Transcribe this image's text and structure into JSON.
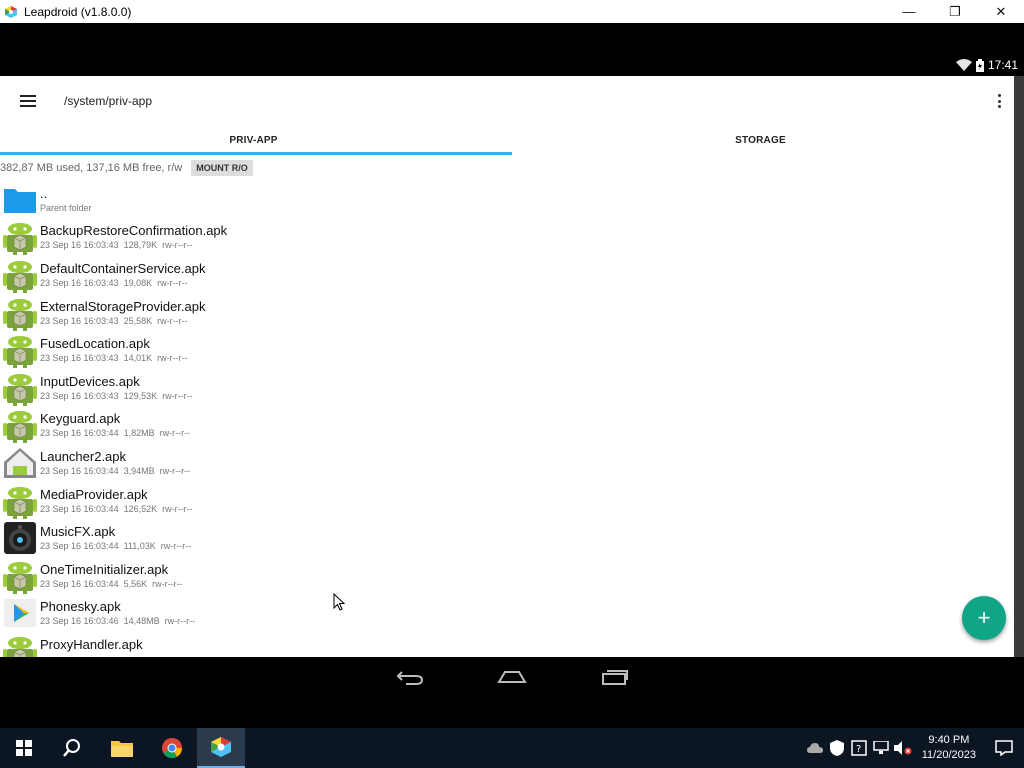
{
  "window": {
    "title": "Leapdroid (v1.8.0.0)",
    "minimize_glyph": "—",
    "restore_glyph": "❐",
    "close_glyph": "✕"
  },
  "android_status": {
    "time": "17:41"
  },
  "toolbar": {
    "path": "/system/priv-app"
  },
  "tabs": [
    {
      "label": "PRIV-APP",
      "selected": true
    },
    {
      "label": "STORAGE",
      "selected": false
    }
  ],
  "storage_info": {
    "text": "382,87 MB used, 137,16 MB free, r/w",
    "mount_button": "MOUNT R/O"
  },
  "files": [
    {
      "name": "..",
      "date": "Parent folder",
      "size": "",
      "perms": "",
      "icon": "folder-icon"
    },
    {
      "name": "BackupRestoreConfirmation.apk",
      "date": "23 Sep 16 16:03:43",
      "size": "128,79K",
      "perms": "rw-r--r--",
      "icon": "android-apk-icon"
    },
    {
      "name": "DefaultContainerService.apk",
      "date": "23 Sep 16 16:03:43",
      "size": "19,08K",
      "perms": "rw-r--r--",
      "icon": "android-apk-icon"
    },
    {
      "name": "ExternalStorageProvider.apk",
      "date": "23 Sep 16 16:03:43",
      "size": "25,58K",
      "perms": "rw-r--r--",
      "icon": "android-apk-icon"
    },
    {
      "name": "FusedLocation.apk",
      "date": "23 Sep 16 16:03:43",
      "size": "14,01K",
      "perms": "rw-r--r--",
      "icon": "android-apk-icon"
    },
    {
      "name": "InputDevices.apk",
      "date": "23 Sep 16 16:03:43",
      "size": "129,53K",
      "perms": "rw-r--r--",
      "icon": "android-apk-icon"
    },
    {
      "name": "Keyguard.apk",
      "date": "23 Sep 16 16:03:44",
      "size": "1,82MB",
      "perms": "rw-r--r--",
      "icon": "android-apk-icon"
    },
    {
      "name": "Launcher2.apk",
      "date": "23 Sep 16 16:03:44",
      "size": "3,94MB",
      "perms": "rw-r--r--",
      "icon": "launcher-home-icon"
    },
    {
      "name": "MediaProvider.apk",
      "date": "23 Sep 16 16:03:44",
      "size": "126,52K",
      "perms": "rw-r--r--",
      "icon": "android-apk-icon"
    },
    {
      "name": "MusicFX.apk",
      "date": "23 Sep 16 16:03:44",
      "size": "111,03K",
      "perms": "rw-r--r--",
      "icon": "speaker-icon"
    },
    {
      "name": "OneTimeInitializer.apk",
      "date": "23 Sep 16 16:03:44",
      "size": "5,56K",
      "perms": "rw-r--r--",
      "icon": "android-apk-icon"
    },
    {
      "name": "Phonesky.apk",
      "date": "23 Sep 16 16:03:46",
      "size": "14,48MB",
      "perms": "rw-r--r--",
      "icon": "play-store-icon"
    },
    {
      "name": "ProxyHandler.apk",
      "date": "",
      "size": "",
      "perms": "",
      "icon": "android-apk-icon"
    }
  ],
  "fab": {
    "label": "+"
  },
  "taskbar": {
    "time": "9:40 PM",
    "date": "11/20/2023"
  },
  "colors": {
    "accent_tab": "#29b6f6",
    "fab": "#11a587",
    "folder": "#1e9be8",
    "android_green": "#8bc34a"
  }
}
